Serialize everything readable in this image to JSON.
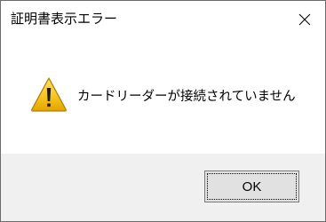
{
  "window": {
    "title": "証明書表示エラー",
    "close_icon": "close-icon"
  },
  "content": {
    "icon": "warning-icon",
    "message": "カードリーダーが接続されていません"
  },
  "buttons": {
    "ok_label": "OK"
  },
  "colors": {
    "footer_background": "#f0f0f0",
    "button_background": "#e1e1e1",
    "warning_yellow": "#f6c21c"
  }
}
